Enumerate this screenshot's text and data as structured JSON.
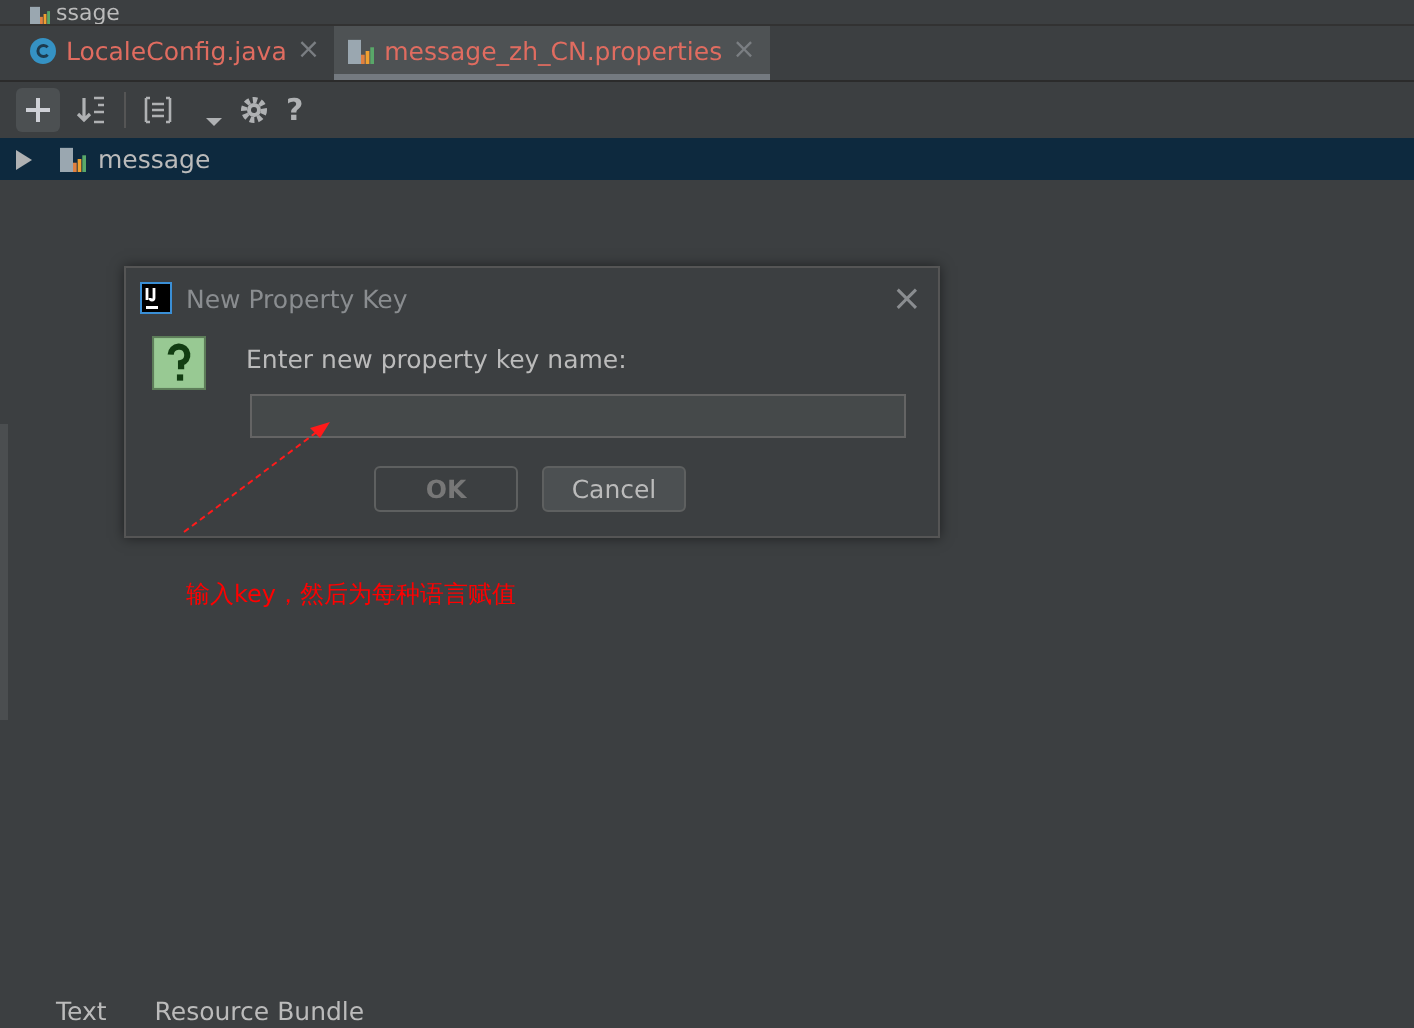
{
  "window": {
    "title": "ssage"
  },
  "tabs": [
    {
      "label": "LocaleConfig.java",
      "selected": false,
      "kind": "java",
      "close": "×"
    },
    {
      "label": "message_zh_CN.properties",
      "selected": true,
      "kind": "properties",
      "close": "×"
    }
  ],
  "toolbar": {
    "help": "?"
  },
  "tree": {
    "items": [
      {
        "label": "message",
        "selected": true,
        "expanded": false
      }
    ]
  },
  "dialog": {
    "title": "New Property Key",
    "close": "×",
    "prompt": "Enter new property key name:",
    "buttons": [
      {
        "label": "OK",
        "disabled": true
      },
      {
        "label": "Cancel",
        "disabled": false
      }
    ]
  },
  "annotation": {
    "text": "输入key，然后为每种语言赋值"
  },
  "bottom_tabs": [
    {
      "label": "Text",
      "selected": false
    },
    {
      "label": "Resource Bundle",
      "selected": false
    }
  ]
}
